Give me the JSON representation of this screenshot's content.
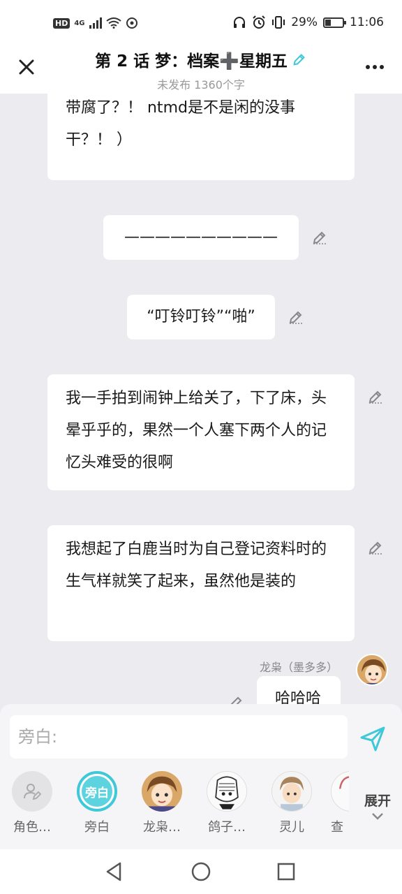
{
  "status_bar": {
    "network_hd": "HD",
    "network_type": "4G",
    "battery_percent_label": "29%",
    "battery_level": 0.29,
    "time": "11:06"
  },
  "header": {
    "title": "第 2 话 梦：档案➕星期五",
    "subtitle": "未发布 1360个字"
  },
  "messages": [
    {
      "text": "带腐了？！ ntmd是不是闲的没事干？！ ）"
    },
    {
      "text": "——————————"
    },
    {
      "text": "“叮铃叮铃”“啪”"
    },
    {
      "text": "我一手拍到闹钟上给关了，下了床，头晕乎乎的，果然一个人塞下两个人的记忆头难受的很啊"
    },
    {
      "text": "我想起了白鹿当时为自己登记资料时的生气样就笑了起来，虽然他是装的"
    },
    {
      "speaker": "龙枭（墨多多）",
      "text": "哈哈哈"
    }
  ],
  "composer": {
    "placeholder": "旁白:"
  },
  "roles": [
    {
      "label": "角色…",
      "icon": "add-role-icon"
    },
    {
      "label": "旁白",
      "avatar_text": "旁白"
    },
    {
      "label": "龙枭…"
    },
    {
      "label": "鸽子…"
    },
    {
      "label": "灵儿"
    },
    {
      "label": "查"
    }
  ],
  "expand_label": "展开",
  "colors": {
    "accent": "#3ec8d8",
    "background": "#ebebf0",
    "bubble": "#ffffff"
  }
}
